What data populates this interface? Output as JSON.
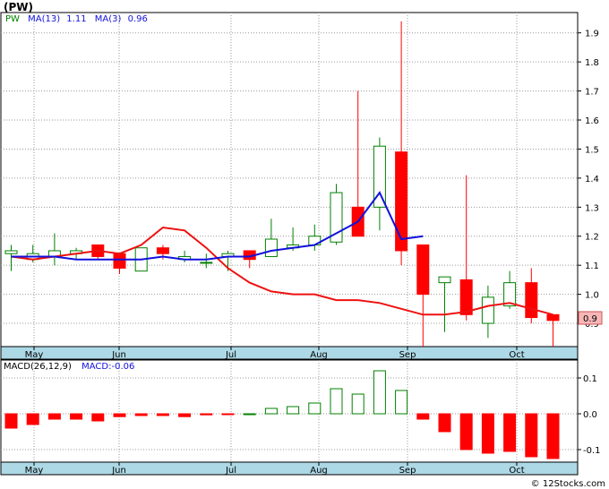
{
  "title": "(PW)",
  "price_legend": {
    "symbol": "PW",
    "ma13_label": "MA(13)",
    "ma13_value": "1.11",
    "ma3_label": "MA(3)",
    "ma3_value": "0.96"
  },
  "macd_legend": {
    "label": "MACD(26,12,9)",
    "value_label": "MACD:-0.06"
  },
  "last_price_tag": "0.9",
  "watermark": "© 12Stocks.com",
  "months": [
    "May",
    "Jun",
    "Jul",
    "Aug",
    "Sep",
    "Oct"
  ],
  "colors": {
    "up": "#008000",
    "down": "#ff0000",
    "ma13": "#ee1111",
    "ma3": "#1111dd",
    "month_band": "#add8e6",
    "grid": "#999999",
    "tag_fill": "#f7b7b7",
    "tag_stroke": "#cc5555"
  },
  "chart_data": [
    {
      "type": "candlestick",
      "name": "price",
      "y_axis_ticks": [
        0.9,
        1.0,
        1.1,
        1.2,
        1.3,
        1.4,
        1.5,
        1.6,
        1.7,
        1.8,
        1.9
      ],
      "ylim": [
        0.82,
        1.97
      ],
      "candles": [
        {
          "o": 1.14,
          "h": 1.17,
          "l": 1.08,
          "c": 1.15
        },
        {
          "o": 1.12,
          "h": 1.17,
          "l": 1.11,
          "c": 1.14
        },
        {
          "o": 1.13,
          "h": 1.21,
          "l": 1.1,
          "c": 1.15
        },
        {
          "o": 1.14,
          "h": 1.16,
          "l": 1.12,
          "c": 1.15
        },
        {
          "o": 1.17,
          "h": 1.17,
          "l": 1.12,
          "c": 1.13
        },
        {
          "o": 1.14,
          "h": 1.14,
          "l": 1.07,
          "c": 1.09
        },
        {
          "o": 1.08,
          "h": 1.16,
          "l": 1.08,
          "c": 1.16
        },
        {
          "o": 1.16,
          "h": 1.17,
          "l": 1.12,
          "c": 1.14
        },
        {
          "o": 1.12,
          "h": 1.15,
          "l": 1.11,
          "c": 1.13
        },
        {
          "o": 1.11,
          "h": 1.14,
          "l": 1.09,
          "c": 1.11
        },
        {
          "o": 1.13,
          "h": 1.15,
          "l": 1.08,
          "c": 1.14
        },
        {
          "o": 1.15,
          "h": 1.15,
          "l": 1.09,
          "c": 1.12
        },
        {
          "o": 1.13,
          "h": 1.26,
          "l": 1.13,
          "c": 1.19
        },
        {
          "o": 1.16,
          "h": 1.23,
          "l": 1.15,
          "c": 1.17
        },
        {
          "o": 1.17,
          "h": 1.24,
          "l": 1.15,
          "c": 1.2
        },
        {
          "o": 1.18,
          "h": 1.38,
          "l": 1.17,
          "c": 1.35
        },
        {
          "o": 1.3,
          "h": 1.7,
          "l": 1.2,
          "c": 1.2
        },
        {
          "o": 1.3,
          "h": 1.54,
          "l": 1.22,
          "c": 1.51
        },
        {
          "o": 1.49,
          "h": 1.94,
          "l": 1.1,
          "c": 1.15
        },
        {
          "o": 1.17,
          "h": 1.17,
          "l": 0.82,
          "c": 1.0
        },
        {
          "o": 1.04,
          "h": 1.06,
          "l": 0.87,
          "c": 1.06
        },
        {
          "o": 1.05,
          "h": 1.41,
          "l": 0.91,
          "c": 0.93
        },
        {
          "o": 0.9,
          "h": 1.03,
          "l": 0.85,
          "c": 0.99
        },
        {
          "o": 0.96,
          "h": 1.08,
          "l": 0.95,
          "c": 1.04
        },
        {
          "o": 1.04,
          "h": 1.09,
          "l": 0.9,
          "c": 0.92
        },
        {
          "o": 0.93,
          "h": 0.93,
          "l": 0.82,
          "c": 0.91
        }
      ],
      "ma3": [
        1.13,
        1.13,
        1.13,
        1.12,
        1.12,
        1.12,
        1.12,
        1.13,
        1.12,
        1.12,
        1.13,
        1.13,
        1.15,
        1.16,
        1.17,
        1.21,
        1.25,
        1.35,
        1.19,
        1.2
      ],
      "ma13": [
        1.13,
        1.12,
        1.13,
        1.14,
        1.15,
        1.14,
        1.17,
        1.23,
        1.22,
        1.16,
        1.09,
        1.04,
        1.01,
        1.0,
        1.0,
        0.98,
        0.98,
        0.97,
        0.95,
        0.93,
        0.93,
        0.94,
        0.96,
        0.97,
        0.95,
        0.93
      ]
    },
    {
      "type": "bar",
      "name": "MACD(26,12,9)",
      "y_axis_ticks": [
        -0.1,
        0.0,
        0.1
      ],
      "ylim": [
        -0.135,
        0.15
      ],
      "values": [
        -0.04,
        -0.03,
        -0.015,
        -0.015,
        -0.02,
        -0.008,
        -0.005,
        -0.005,
        -0.008,
        -0.003,
        -0.002,
        0.0,
        0.015,
        0.02,
        0.03,
        0.07,
        0.055,
        0.12,
        0.065,
        -0.015,
        -0.05,
        -0.1,
        -0.11,
        -0.105,
        -0.12,
        -0.125
      ]
    }
  ]
}
